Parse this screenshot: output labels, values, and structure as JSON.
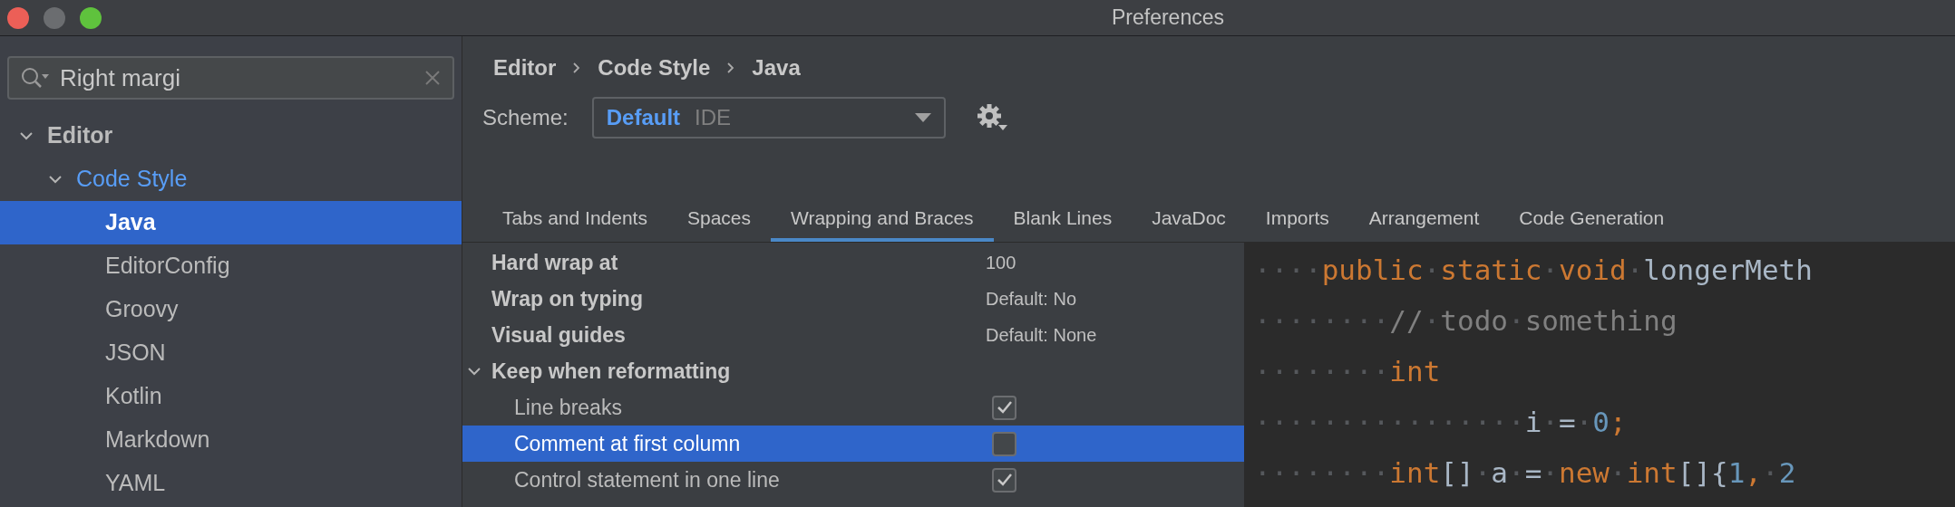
{
  "window": {
    "title": "Preferences",
    "traffic_lights": [
      {
        "kind": "close",
        "disabled": false
      },
      {
        "kind": "minimize",
        "disabled": true
      },
      {
        "kind": "zoom",
        "disabled": false
      }
    ]
  },
  "sidebar": {
    "search": {
      "value": "Right margi"
    },
    "tree": [
      {
        "label": "Editor",
        "expanded": true,
        "selected": false,
        "highlighted": false,
        "children": [
          {
            "label": "Code Style",
            "expanded": true,
            "selected": false,
            "highlighted": true,
            "children": [
              {
                "label": "Java",
                "selected": true,
                "highlighted": false
              },
              {
                "label": "EditorConfig",
                "selected": false,
                "highlighted": false
              },
              {
                "label": "Groovy",
                "selected": false,
                "highlighted": false
              },
              {
                "label": "JSON",
                "selected": false,
                "highlighted": false
              },
              {
                "label": "Kotlin",
                "selected": false,
                "highlighted": false
              },
              {
                "label": "Markdown",
                "selected": false,
                "highlighted": false
              },
              {
                "label": "YAML",
                "selected": false,
                "highlighted": false
              }
            ]
          }
        ]
      }
    ]
  },
  "breadcrumb": [
    "Editor",
    "Code Style",
    "Java"
  ],
  "scheme": {
    "label": "Scheme:",
    "name": "Default",
    "type": "IDE"
  },
  "tabs": [
    {
      "label": "Tabs and Indents",
      "selected": false
    },
    {
      "label": "Spaces",
      "selected": false
    },
    {
      "label": "Wrapping and Braces",
      "selected": true
    },
    {
      "label": "Blank Lines",
      "selected": false
    },
    {
      "label": "JavaDoc",
      "selected": false
    },
    {
      "label": "Imports",
      "selected": false
    },
    {
      "label": "Arrangement",
      "selected": false
    },
    {
      "label": "Code Generation",
      "selected": false
    }
  ],
  "settings": [
    {
      "kind": "option",
      "label": "Hard wrap at",
      "value": "100"
    },
    {
      "kind": "option",
      "label": "Wrap on typing",
      "value": "Default: No"
    },
    {
      "kind": "option",
      "label": "Visual guides",
      "value": "Default: None"
    },
    {
      "kind": "group",
      "label": "Keep when reformatting",
      "expanded": true
    },
    {
      "kind": "checkbox",
      "label": "Line breaks",
      "checked": true,
      "selected": false
    },
    {
      "kind": "checkbox",
      "label": "Comment at first column",
      "checked": false,
      "selected": true
    },
    {
      "kind": "checkbox",
      "label": "Control statement in one line",
      "checked": true,
      "selected": false
    }
  ],
  "code": [
    [
      {
        "kind": "space",
        "text": "····"
      },
      {
        "kind": "keyword",
        "text": "public"
      },
      {
        "kind": "space",
        "text": "·"
      },
      {
        "kind": "keyword",
        "text": "static"
      },
      {
        "kind": "space",
        "text": "·"
      },
      {
        "kind": "keyword",
        "text": "void"
      },
      {
        "kind": "space",
        "text": "·"
      },
      {
        "kind": "ident",
        "text": "longerMeth"
      }
    ],
    [
      {
        "kind": "space",
        "text": "········"
      },
      {
        "kind": "comment",
        "text": "//"
      },
      {
        "kind": "space",
        "text": "·"
      },
      {
        "kind": "comment",
        "text": "todo"
      },
      {
        "kind": "space",
        "text": "·"
      },
      {
        "kind": "comment",
        "text": "something"
      }
    ],
    [
      {
        "kind": "space",
        "text": "········"
      },
      {
        "kind": "keyword",
        "text": "int"
      }
    ],
    [
      {
        "kind": "space",
        "text": "················"
      },
      {
        "kind": "ident",
        "text": "i"
      },
      {
        "kind": "space",
        "text": "·"
      },
      {
        "kind": "ident",
        "text": "="
      },
      {
        "kind": "space",
        "text": "·"
      },
      {
        "kind": "number",
        "text": "0"
      },
      {
        "kind": "keyword",
        "text": ";"
      }
    ],
    [
      {
        "kind": "space",
        "text": "········"
      },
      {
        "kind": "keyword",
        "text": "int"
      },
      {
        "kind": "ident",
        "text": "[]"
      },
      {
        "kind": "space",
        "text": "·"
      },
      {
        "kind": "ident",
        "text": "a"
      },
      {
        "kind": "space",
        "text": "·"
      },
      {
        "kind": "ident",
        "text": "="
      },
      {
        "kind": "space",
        "text": "·"
      },
      {
        "kind": "keyword",
        "text": "new"
      },
      {
        "kind": "space",
        "text": "·"
      },
      {
        "kind": "keyword",
        "text": "int"
      },
      {
        "kind": "ident",
        "text": "[]{"
      },
      {
        "kind": "number",
        "text": "1"
      },
      {
        "kind": "keyword",
        "text": ","
      },
      {
        "kind": "space",
        "text": "·"
      },
      {
        "kind": "number",
        "text": "2"
      }
    ]
  ]
}
